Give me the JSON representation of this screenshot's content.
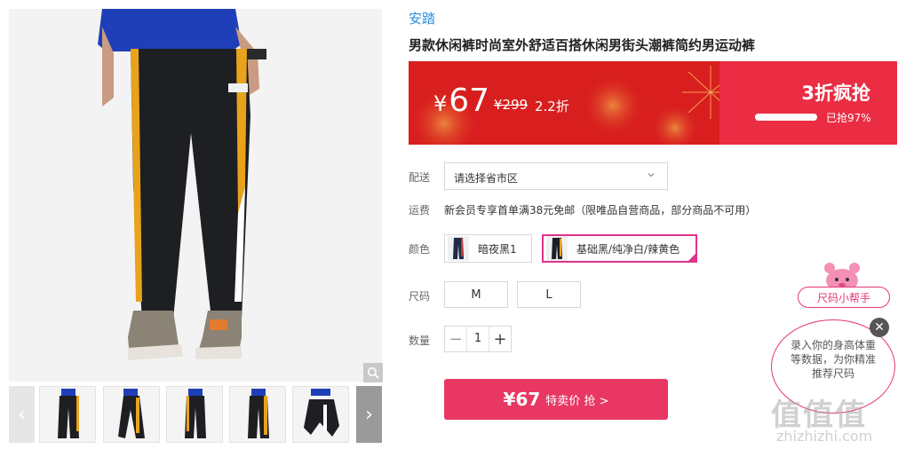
{
  "product": {
    "brand": "安踏",
    "title": "男款休闲裤时尚室外舒适百搭休闲男街头潮裤简约男运动裤"
  },
  "price_banner": {
    "currency": "¥",
    "price": "67",
    "original_price": "¥299",
    "discount": "2.2折",
    "flash_title": "3折疯抢",
    "sold_text": "已抢97%",
    "sold_fraction": 0.97
  },
  "delivery": {
    "label": "配送",
    "placeholder": "请选择省市区"
  },
  "shipping": {
    "label": "运费",
    "text": "新会员专享首单满38元免邮（限唯品自营商品，部分商品不可用）"
  },
  "color": {
    "label": "颜色",
    "options": [
      "暗夜黑1",
      "基础黑/纯净白/辣黄色"
    ],
    "selected_index": 1
  },
  "size": {
    "label": "尺码",
    "options": [
      "M",
      "L"
    ]
  },
  "quantity": {
    "label": "数量",
    "value": "1",
    "minus": "−",
    "plus": "+"
  },
  "buy_button": {
    "price": "¥67",
    "text": "特卖价 抢 >"
  },
  "size_helper": {
    "tag": "尺码小帮手",
    "bubble_text": "录入你的身高体重等数据，为你精准推荐尺码",
    "close": "✕"
  },
  "gallery": {
    "prev": "‹",
    "next": "›",
    "thumb_count": 5
  },
  "watermark": {
    "big": "值值值",
    "small": "zhizhizhi.com"
  },
  "colors": {
    "brand_blue": "#2f8fdb",
    "banner_red": "#d81e1e",
    "accent_pink": "#e83763"
  }
}
